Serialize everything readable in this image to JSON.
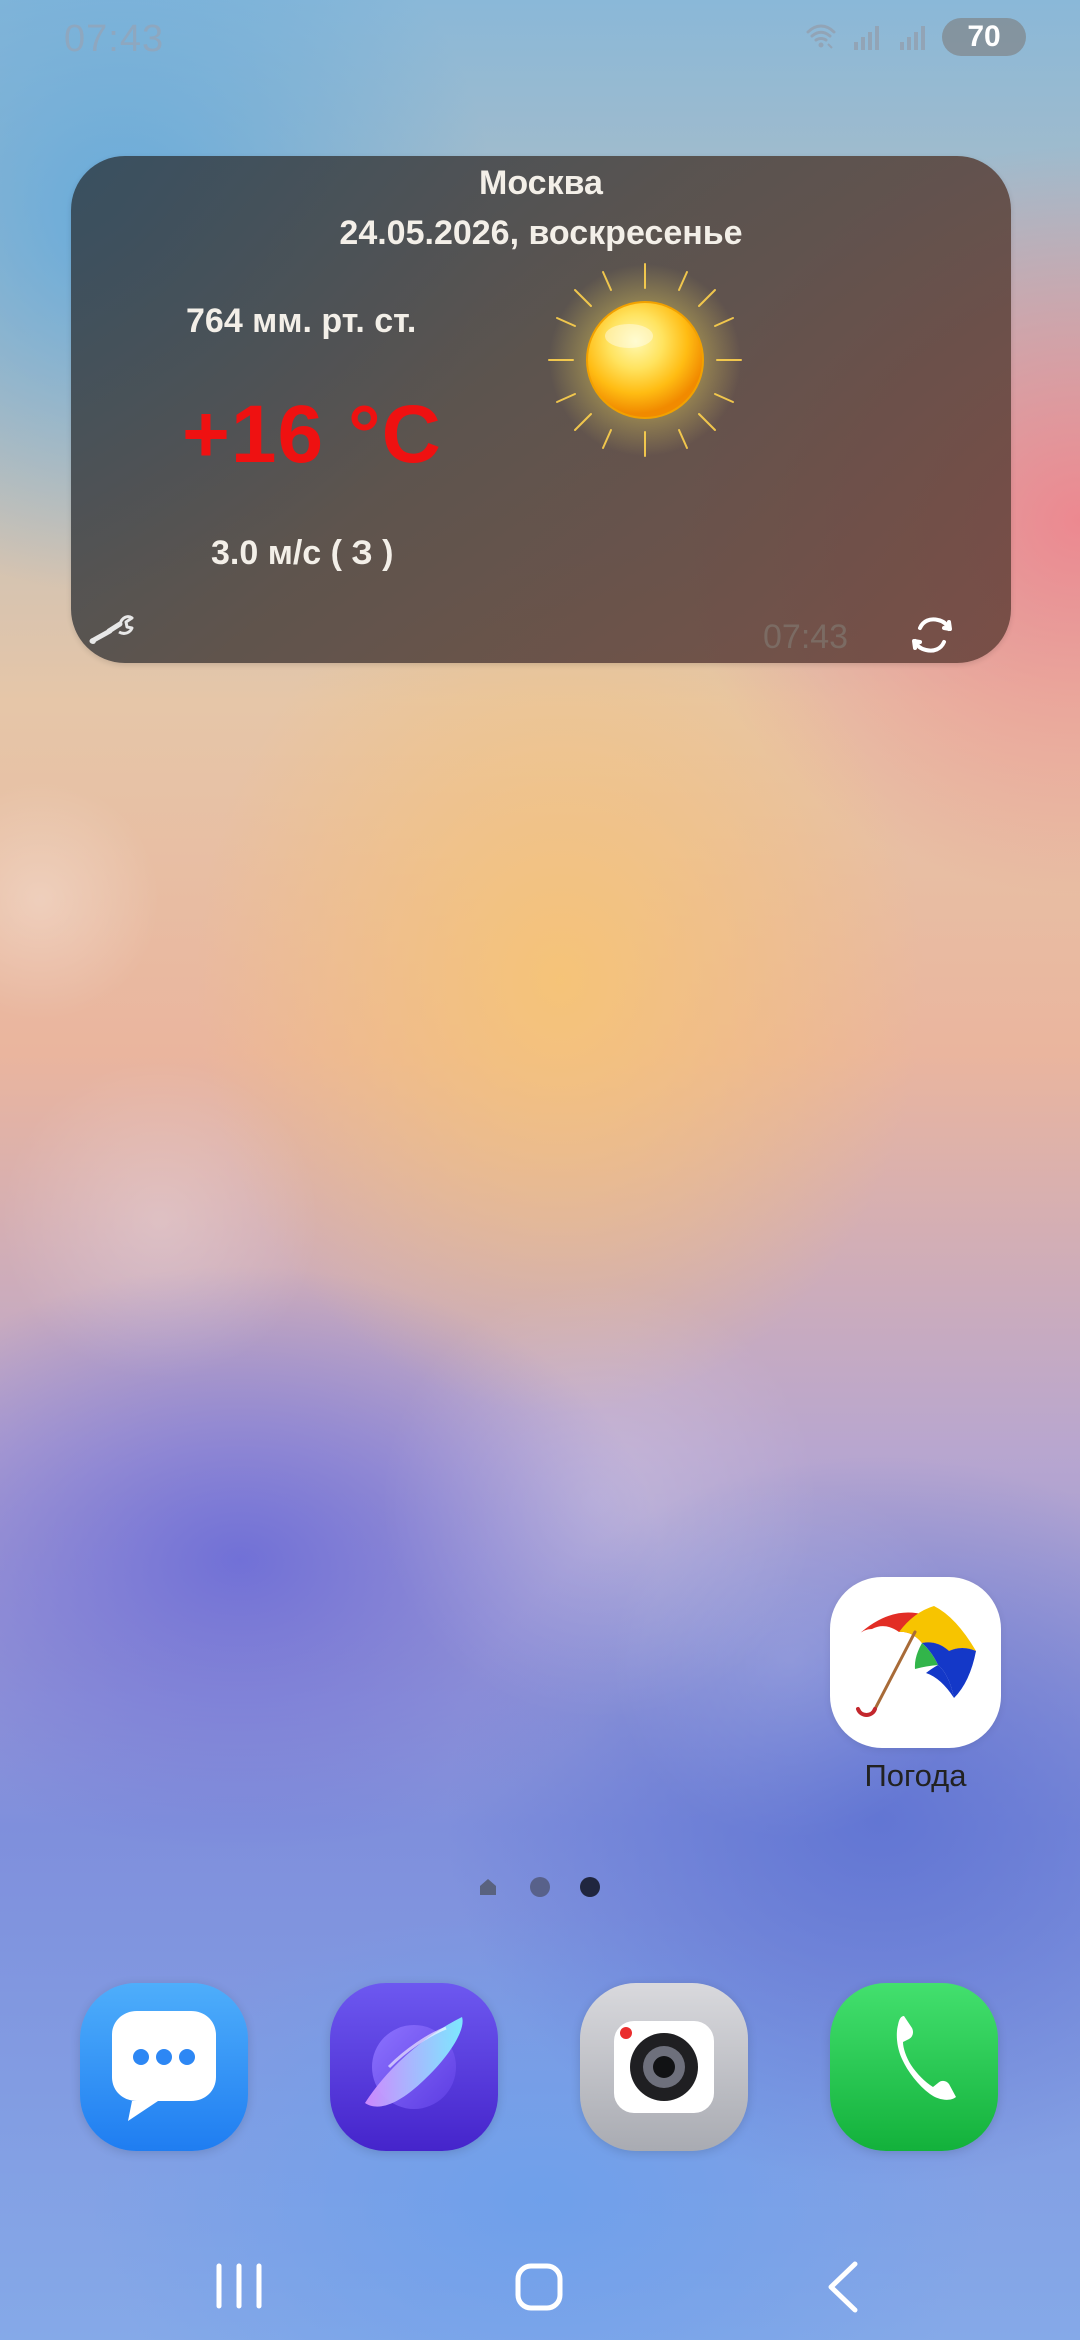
{
  "status_bar": {
    "time": "07:43",
    "battery": "70"
  },
  "weather_widget": {
    "city": "Москва",
    "date": "24.05.2026, воскресенье",
    "pressure": "764 мм. рт. ст.",
    "temperature": "+16 °C",
    "wind": "3.0 м/с ( З )",
    "updated_time": "07:43"
  },
  "desktop_apps": [
    {
      "label": "Погода",
      "icon": "umbrella-icon"
    }
  ],
  "dock": [
    {
      "icon": "messages-icon"
    },
    {
      "icon": "internet-icon"
    },
    {
      "icon": "camera-icon"
    },
    {
      "icon": "phone-icon"
    }
  ],
  "navigation": {
    "recents_icon": "recents-icon",
    "home_icon": "home-icon",
    "back_icon": "back-icon"
  },
  "colors": {
    "temperature": "#ef1111",
    "widget_text": "#f3efe8",
    "status_text": "#8ea7bf",
    "battery_bg": "#7e7e7e",
    "label_text": "#222222",
    "messages": "#1f7df1",
    "internet": "#4524cb",
    "phone": "#13b13b"
  }
}
